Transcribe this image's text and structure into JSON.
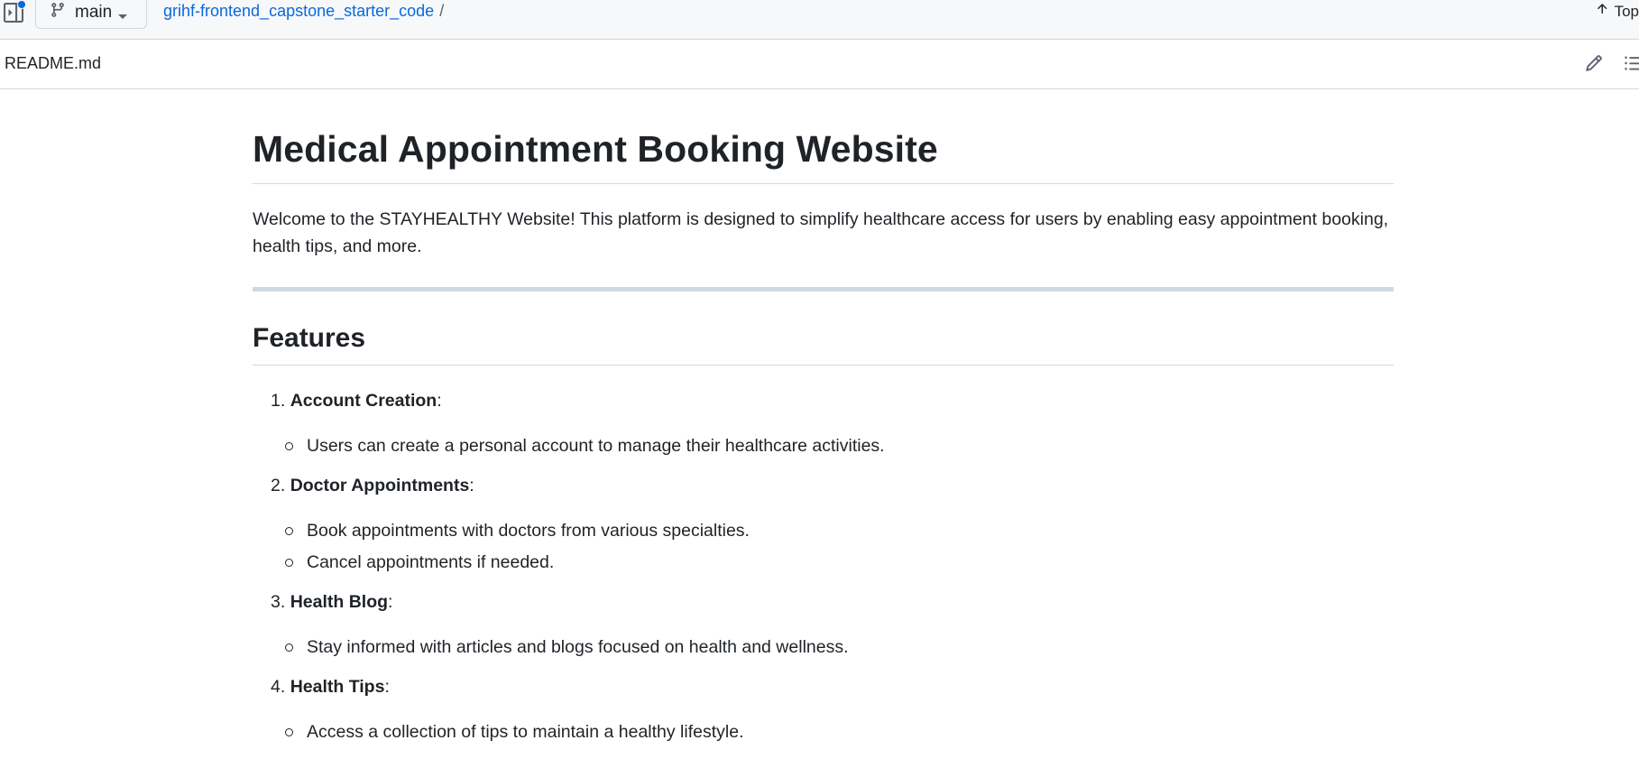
{
  "topbar": {
    "branch": "main",
    "repo": "grihf-frontend_capstone_starter_code",
    "separator": "/",
    "top_link": "Top"
  },
  "file": {
    "name": "README.md"
  },
  "readme": {
    "title": "Medical Appointment Booking Website",
    "intro": "Welcome to the STAYHEALTHY Website! This platform is designed to simplify healthcare access for users by enabling easy appointment booking, health tips, and more.",
    "features_heading": "Features",
    "features": [
      {
        "number": "1.",
        "name": "Account Creation",
        "suffix": ":",
        "items": [
          "Users can create a personal account to manage their healthcare activities."
        ]
      },
      {
        "number": "2.",
        "name": "Doctor Appointments",
        "suffix": ":",
        "items": [
          "Book appointments with doctors from various specialties.",
          "Cancel appointments if needed."
        ]
      },
      {
        "number": "3.",
        "name": "Health Blog",
        "suffix": ":",
        "items": [
          "Stay informed with articles and blogs focused on health and wellness."
        ]
      },
      {
        "number": "4.",
        "name": "Health Tips",
        "suffix": ":",
        "items": [
          "Access a collection of tips to maintain a healthy lifestyle."
        ]
      }
    ]
  },
  "colors": {
    "link": "#0969da",
    "border": "#d1d9e0",
    "text": "#1f2328",
    "topbar_bg": "#f6f8fa"
  },
  "icons": [
    "sidebar-toggle-icon",
    "git-branch-icon",
    "triangle-down-icon",
    "arrow-up-icon",
    "pencil-icon",
    "list-unordered-icon"
  ]
}
